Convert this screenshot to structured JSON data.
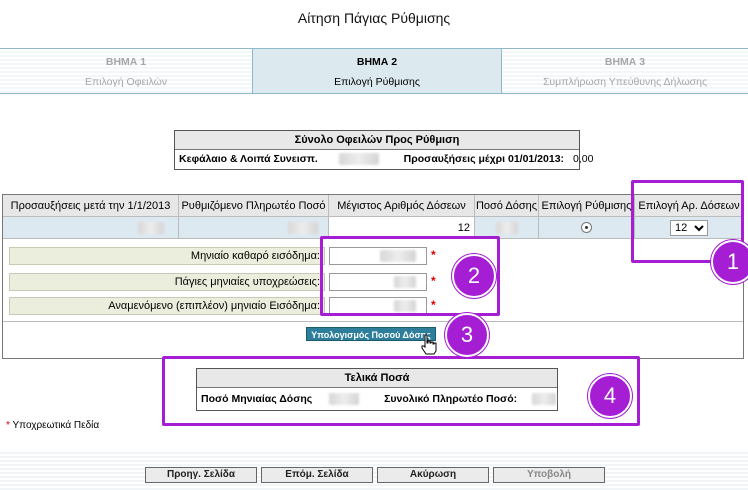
{
  "page": {
    "title": "Αίτηση Πάγιας Ρύθμισης"
  },
  "steps": [
    {
      "num": "ΒΗΜΑ 1",
      "label": "Επιλογή Οφειλών"
    },
    {
      "num": "ΒΗΜΑ 2",
      "label": "Επιλογή Ρύθμισης"
    },
    {
      "num": "ΒΗΜΑ 3",
      "label": "Συμπλήρωση Υπεύθυνης Δήλωσης"
    }
  ],
  "summary": {
    "title": "Σύνολο Οφειλών Προς Ρύθμιση",
    "principal_label": "Κεφάλαιο & Λοιπά Συνεισπ.",
    "surcharges_label": "Προσαυξήσεις μέχρι 01/01/2013:",
    "surcharges_value": "0,00"
  },
  "grid": {
    "headers": [
      "Προσαυξήσεις μετά την 1/1/2013",
      "Ρυθμιζόμενο Πληρωτέο Ποσό",
      "Μέγιστος Αριθμός Δόσεων",
      "Ποσό Δόσης",
      "Επιλογή Ρύθμισης",
      "Επιλογή Αρ. Δόσεων"
    ],
    "max_installments": "12",
    "selected_installments": "12",
    "installment_options": [
      "12"
    ]
  },
  "form": {
    "monthly_income_label": "Μηνιαίο καθαρό εισόδημα:",
    "fixed_obligations_label": "Πάγιες μηνιαίες υποχρεώσεις:",
    "expected_income_label": "Αναμενόμενο (επιπλέον) μηνιαίο Εισόδημα:",
    "required_mark": "*",
    "calculate_button": "Υπολογισμός Ποσού Δόσης"
  },
  "final": {
    "title": "Τελικά Ποσά",
    "monthly_label": "Ποσό Μηνιαίας Δόσης",
    "total_label": "Συνολικό Πληρωτέο Ποσό:"
  },
  "required_note": {
    "star": "*",
    "text": "Υποχρεωτικά Πεδία"
  },
  "badges": [
    "1",
    "2",
    "3",
    "4"
  ],
  "footer": {
    "prev": "Προηγ. Σελίδα",
    "next": "Επόμ. Σελίδα",
    "cancel": "Ακύρωση",
    "submit": "Υποβολή"
  },
  "colors": {
    "highlight": "#a51ed3",
    "accent": "#2d7e9a"
  }
}
